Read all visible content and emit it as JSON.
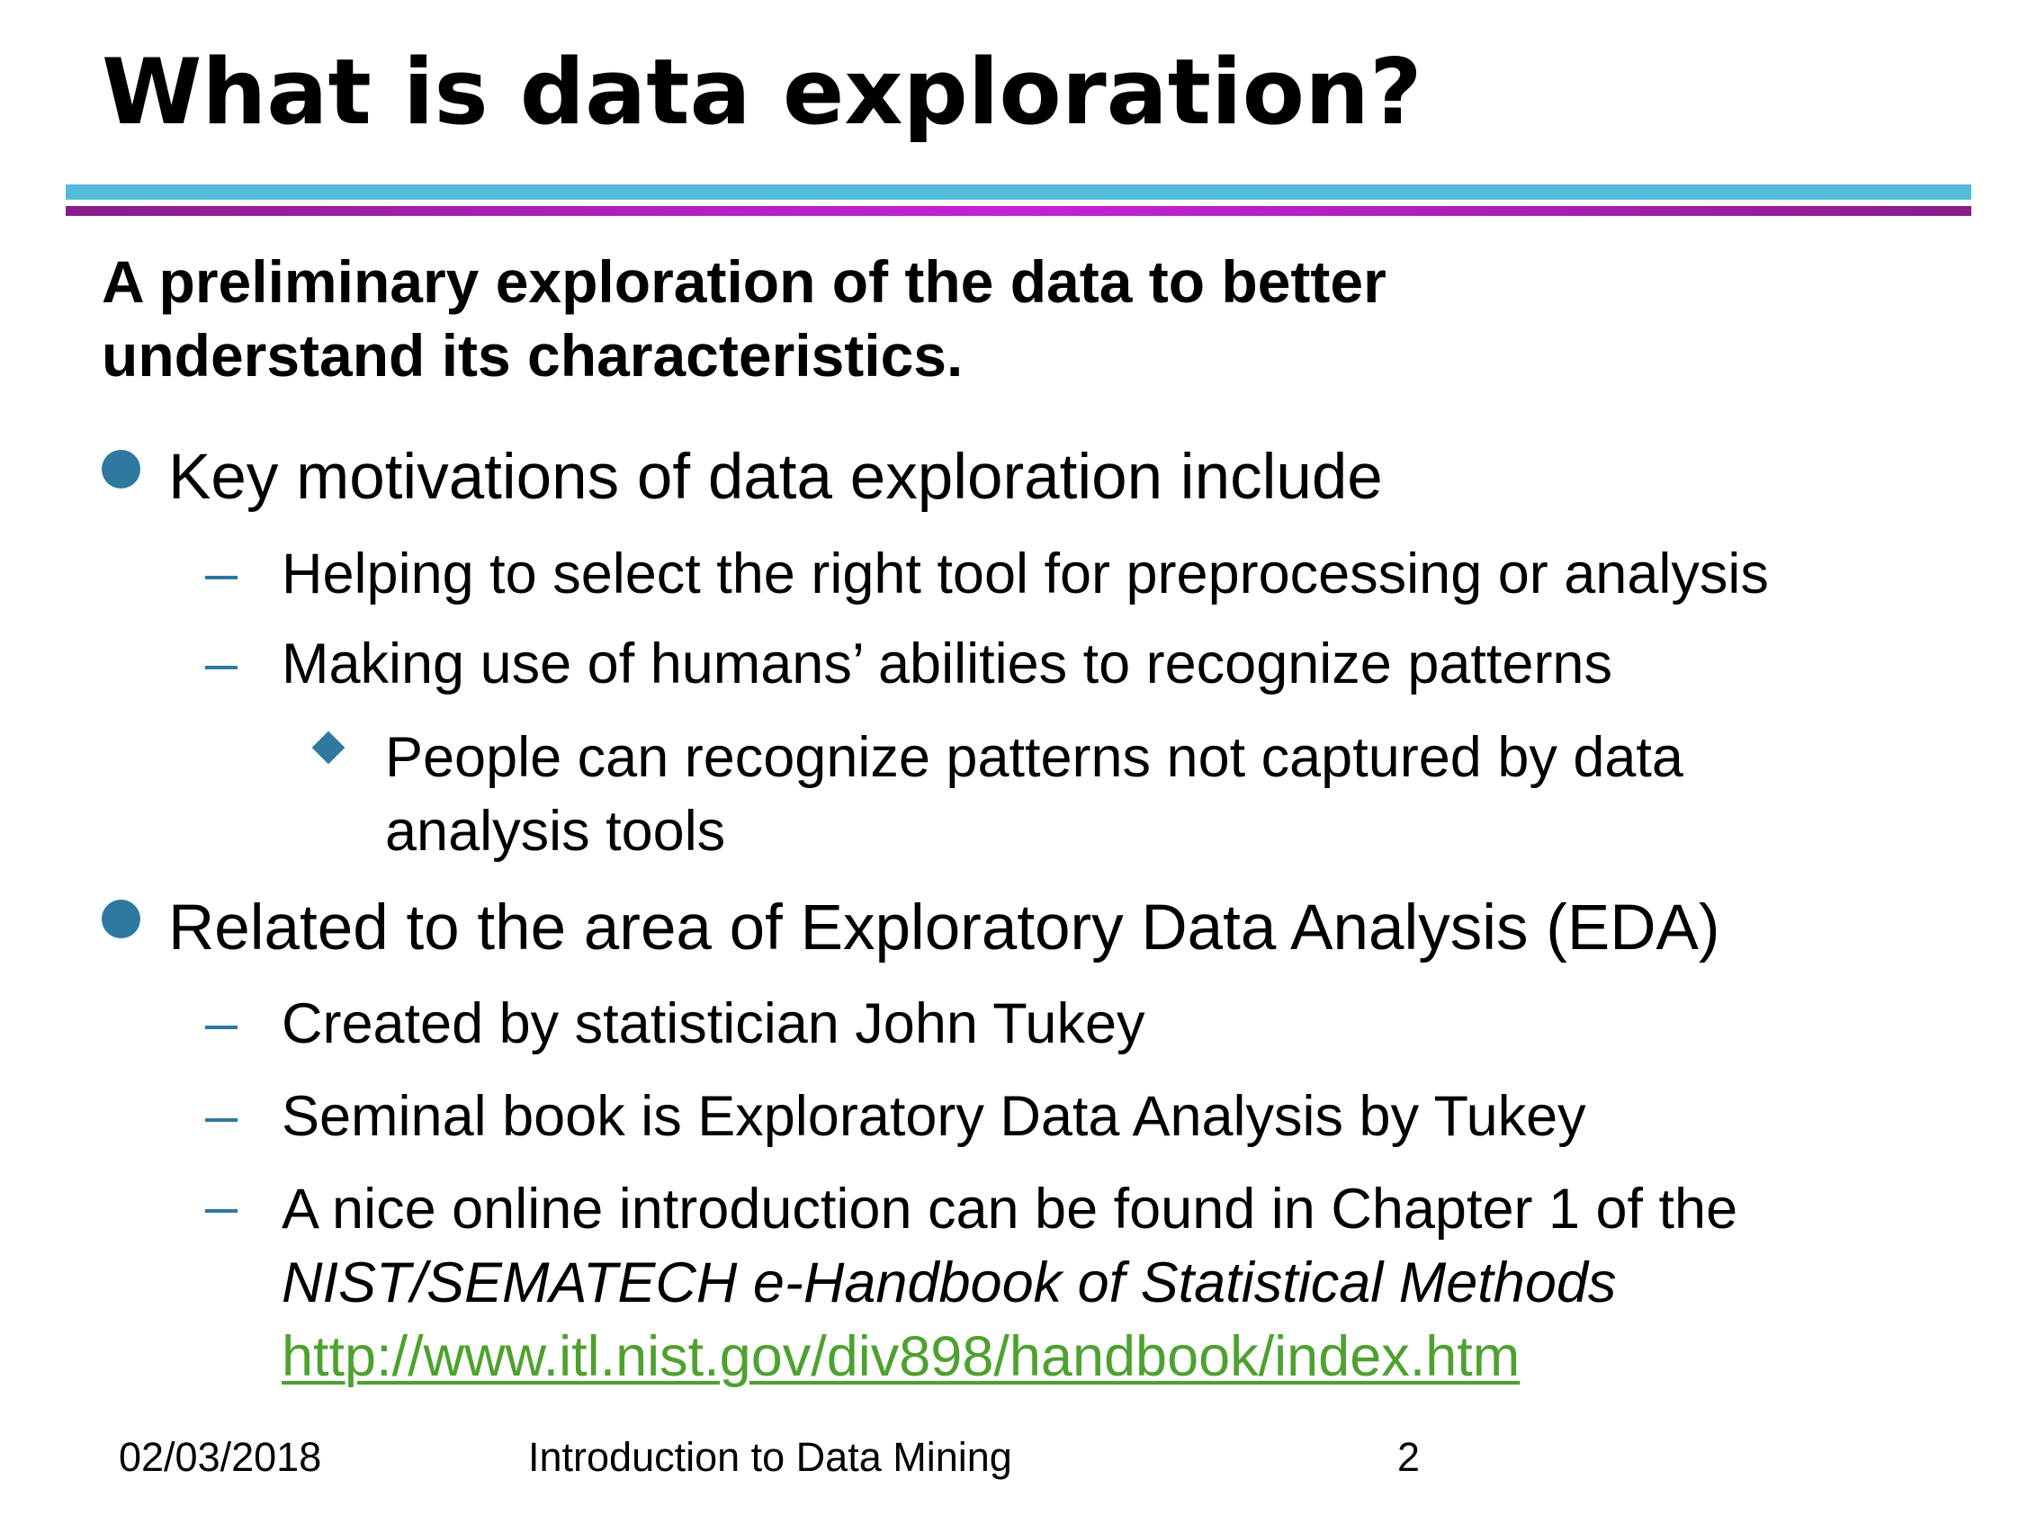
{
  "slide": {
    "title": "What is data exploration?",
    "subtitle_line1": "A preliminary exploration of the data to better",
    "subtitle_line2": "understand its characteristics.",
    "bullet1": "Key motivations of data exploration include",
    "bullet1_sub1": "Helping to select the right tool for preprocessing or analysis",
    "bullet1_sub2": "Making use of humans’ abilities to recognize patterns",
    "bullet1_sub2_sub_line1": "People can recognize patterns not captured by data",
    "bullet1_sub2_sub_line2": "analysis tools",
    "bullet2": "Related to the area of Exploratory Data Analysis (EDA)",
    "bullet2_sub1": "Created by statistician John Tukey",
    "bullet2_sub2": "Seminal book is Exploratory Data Analysis by Tukey",
    "bullet2_sub3_line1": "A nice online introduction can be found in Chapter 1 of the",
    "bullet2_sub3_line2": "NIST/SEMATECH e-Handbook of Statistical Methods",
    "bullet2_sub3_link": "http://www.itl.nist.gov/div898/handbook/index.htm"
  },
  "footer": {
    "date": "02/03/2018",
    "course": "Introduction to Data Mining",
    "page": "2"
  },
  "colors": {
    "accent_blue": "#2f78a0",
    "rule_blue": "#54bcdb",
    "rule_purple": "#b620c6",
    "link_green": "#4ea12f"
  }
}
